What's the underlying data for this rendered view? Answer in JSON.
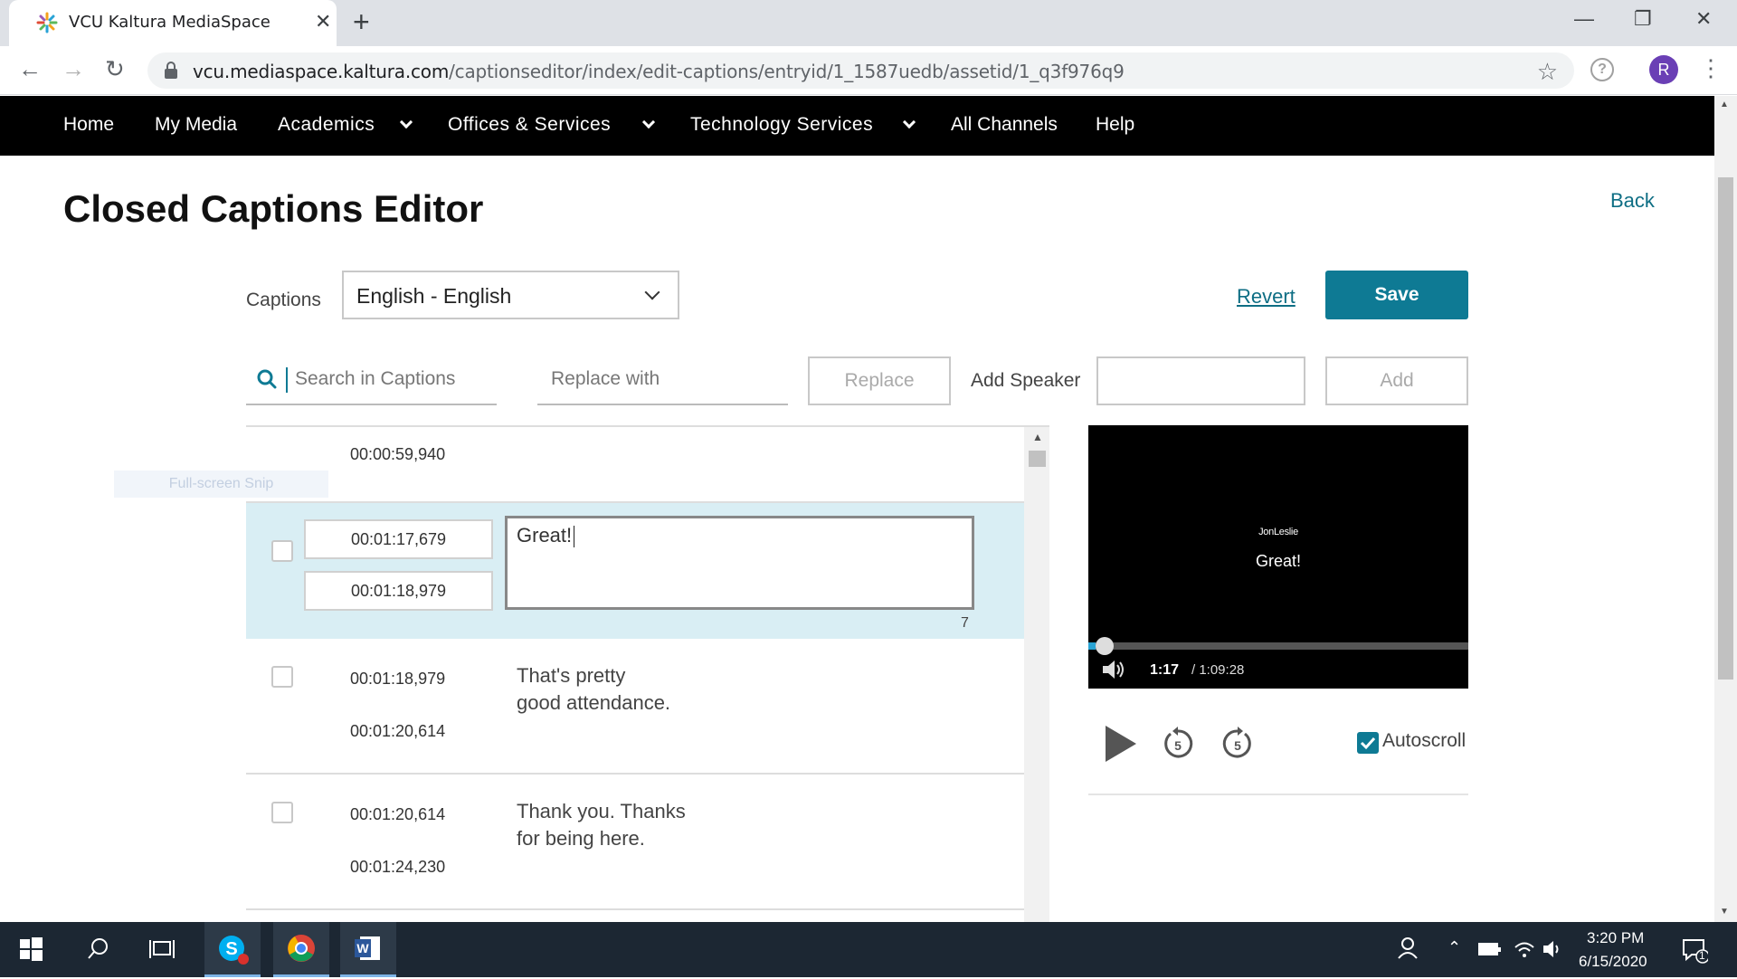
{
  "browser": {
    "tab_title": "VCU Kaltura MediaSpace",
    "url_host": "vcu.mediaspace.kaltura.com",
    "url_path": "/captionseditor/index/edit-captions/entryid/1_1587uedb/assetid/1_q3f976q9",
    "profile_initial": "R",
    "help_glyph": "?"
  },
  "nav": {
    "items": [
      {
        "label": "Home"
      },
      {
        "label": "My Media"
      },
      {
        "label": "Academics"
      },
      {
        "label": "Offices & Services"
      },
      {
        "label": "Technology Services"
      },
      {
        "label": "All Channels"
      },
      {
        "label": "Help"
      }
    ]
  },
  "editor": {
    "title": "Closed Captions Editor",
    "back_label": "Back",
    "captions_label": "Captions",
    "captions_selected": "English - English",
    "revert_label": "Revert",
    "save_label": "Save",
    "search_placeholder": "Search in Captions",
    "replace_placeholder": "Replace with",
    "replace_button": "Replace",
    "add_speaker_label": "Add Speaker",
    "add_button": "Add"
  },
  "overlay": {
    "snip_label": "Full-screen Snip"
  },
  "captions": {
    "partial_end": "00:00:59,940",
    "active": {
      "start": "00:01:17,679",
      "end": "00:01:18,979",
      "text": "Great!",
      "char_count": "7"
    },
    "rows": [
      {
        "start": "00:01:18,979",
        "end": "00:01:20,614",
        "line1": "That's pretty",
        "line2": "good attendance."
      },
      {
        "start": "00:01:20,614",
        "end": "00:01:24,230",
        "line1": "Thank you. Thanks",
        "line2": "for being here."
      }
    ]
  },
  "player": {
    "speaker": "JonLeslie",
    "caption": "Great!",
    "current_time": "1:17",
    "total_time": "/ 1:09:28",
    "progress_fraction": 0.0185,
    "autoscroll_label": "Autoscroll",
    "autoscroll_checked": true
  },
  "taskbar": {
    "time": "3:20 PM",
    "date": "6/15/2020",
    "notification_count": "1"
  },
  "colors": {
    "accent": "#0e7a94",
    "active_row": "#d9eef4",
    "nav_bg": "#000000"
  }
}
